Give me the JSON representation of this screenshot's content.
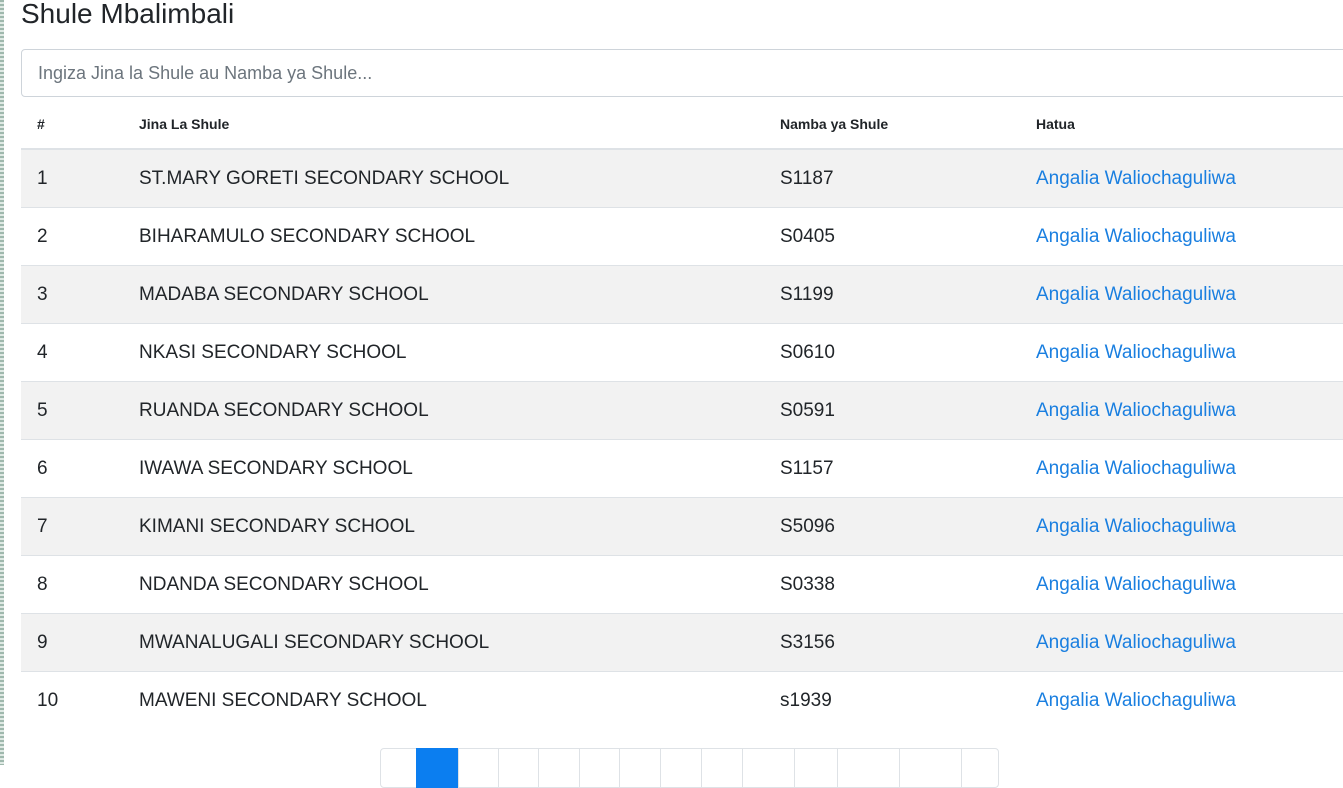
{
  "page": {
    "title": "Shule Mbalimbali"
  },
  "search": {
    "placeholder": "Ingiza Jina la Shule au Namba ya Shule...",
    "value": ""
  },
  "table": {
    "headers": {
      "number": "#",
      "name": "Jina La Shule",
      "code": "Namba ya Shule",
      "action": "Hatua"
    },
    "rows": [
      {
        "number": "1",
        "name": "ST.MARY GORETI SECONDARY SCHOOL",
        "code": "S1187",
        "action": "Angalia Waliochaguliwa"
      },
      {
        "number": "2",
        "name": "BIHARAMULO SECONDARY SCHOOL",
        "code": "S0405",
        "action": "Angalia Waliochaguliwa"
      },
      {
        "number": "3",
        "name": "MADABA SECONDARY SCHOOL",
        "code": "S1199",
        "action": "Angalia Waliochaguliwa"
      },
      {
        "number": "4",
        "name": "NKASI SECONDARY SCHOOL",
        "code": "S0610",
        "action": "Angalia Waliochaguliwa"
      },
      {
        "number": "5",
        "name": "RUANDA SECONDARY SCHOOL",
        "code": "S0591",
        "action": "Angalia Waliochaguliwa"
      },
      {
        "number": "6",
        "name": "IWAWA SECONDARY SCHOOL",
        "code": "S1157",
        "action": "Angalia Waliochaguliwa"
      },
      {
        "number": "7",
        "name": "KIMANI SECONDARY SCHOOL",
        "code": "S5096",
        "action": "Angalia Waliochaguliwa"
      },
      {
        "number": "8",
        "name": "NDANDA SECONDARY SCHOOL",
        "code": "S0338",
        "action": "Angalia Waliochaguliwa"
      },
      {
        "number": "9",
        "name": "MWANALUGALI SECONDARY SCHOOL",
        "code": "S3156",
        "action": "Angalia Waliochaguliwa"
      },
      {
        "number": "10",
        "name": "MAWENI SECONDARY SCHOOL",
        "code": "s1939",
        "action": "Angalia Waliochaguliwa"
      }
    ]
  },
  "pagination": {
    "active_index": 1,
    "count": 15
  },
  "colors": {
    "link": "#1a7fe0",
    "active_page": "#0b7ef0",
    "stripe": "#f2f2f2"
  }
}
